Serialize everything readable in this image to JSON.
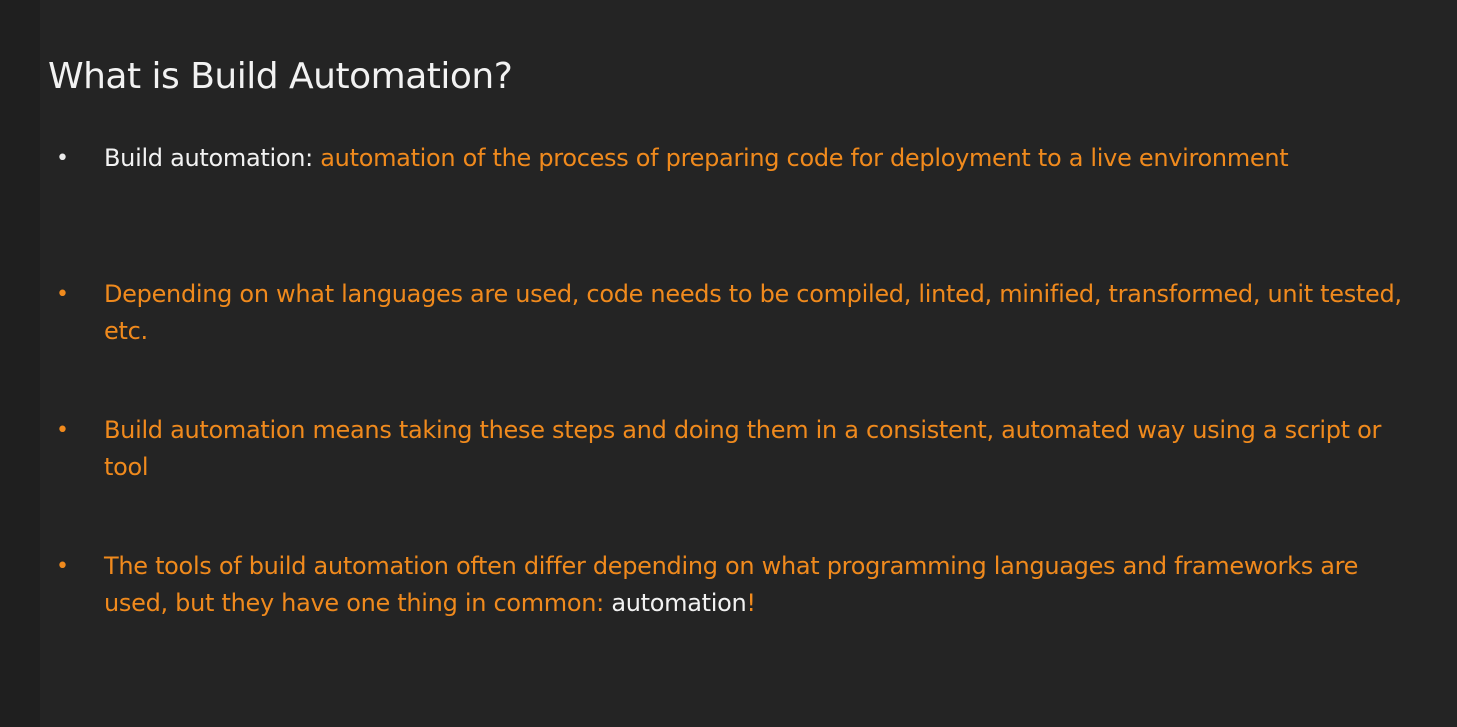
{
  "slide": {
    "title": "What is Build Automation?",
    "bullets": [
      {
        "term": "Build automation:",
        "text": " automation of the process of preparing code for deployment to a live environment"
      },
      {
        "text": "Depending on what languages are used, code needs to be compiled, linted, minified, transformed, unit tested, etc."
      },
      {
        "text": "Build automation means taking these steps and doing them in a consistent, automated way using a script or tool"
      },
      {
        "text_before": "The tools of build automation often differ depending on what programming languages and frameworks are used, but they have one thing in common: ",
        "highlight": "automation",
        "text_after": "!"
      }
    ],
    "bullet_symbol": "•"
  },
  "colors": {
    "background": "#242424",
    "title": "#f2f2f2",
    "accent": "#f08a1d",
    "highlight": "#f2f2f2"
  }
}
